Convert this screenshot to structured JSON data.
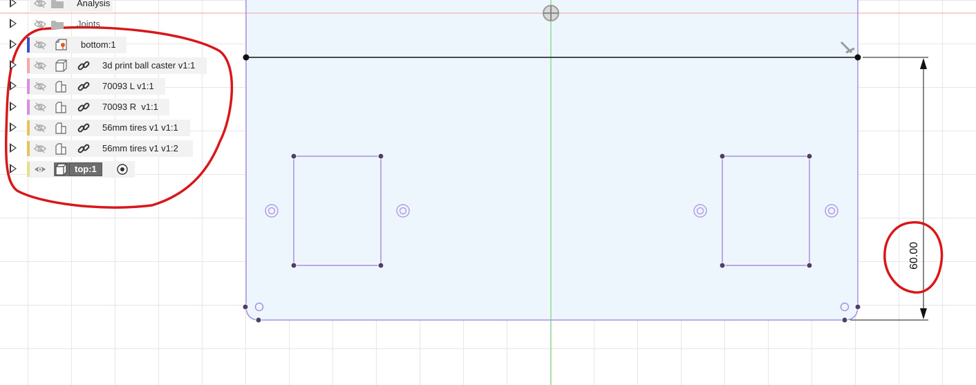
{
  "browser": {
    "folders": [
      {
        "label": "Analysis",
        "icon": "folder-icon"
      },
      {
        "label": "Joints",
        "icon": "folder-icon"
      }
    ],
    "components": [
      {
        "label": "bottom:1",
        "color": "#3b4fd0",
        "icon": "component-pin-icon",
        "visible": false,
        "linked": false
      },
      {
        "label": "3d print ball caster v1:1",
        "color": "#f4a7ad",
        "icon": "body-icon",
        "visible": false,
        "linked": true
      },
      {
        "label": "70093 L v1:1",
        "color": "#d98fe0",
        "icon": "multi-body-icon",
        "visible": false,
        "linked": true
      },
      {
        "label": "70093 R  v1:1",
        "color": "#d98fe0",
        "icon": "multi-body-icon",
        "visible": false,
        "linked": true
      },
      {
        "label": "56mm tires v1 v1:1",
        "color": "#e8c35a",
        "icon": "multi-body-icon",
        "visible": false,
        "linked": true
      },
      {
        "label": "56mm tires v1 v1:2",
        "color": "#e8c35a",
        "icon": "multi-body-icon",
        "visible": false,
        "linked": true
      },
      {
        "label": "top:1",
        "color": "#e6e08a",
        "icon": "body-icon",
        "visible": true,
        "linked": false,
        "active": true
      }
    ]
  },
  "sketch": {
    "dimension_label": "60.00"
  },
  "colors": {
    "sketch_line": "#a88fe0",
    "profile_fill": "#eef6fd",
    "annotation_red": "#d9171b",
    "y_axis": "#5fd35f",
    "x_axis": "#f2a0a0"
  }
}
